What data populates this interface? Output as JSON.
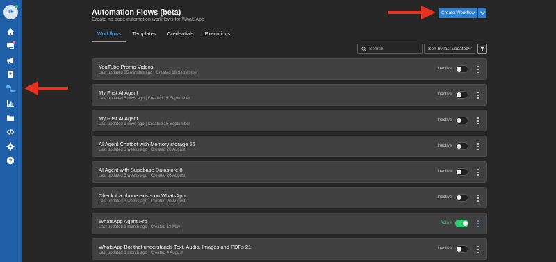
{
  "sidebar": {
    "avatar_initials": "TE",
    "items": [
      {
        "icon": "home-icon"
      },
      {
        "icon": "chat-icon"
      },
      {
        "icon": "megaphone-icon"
      },
      {
        "icon": "contacts-icon"
      },
      {
        "icon": "flows-icon",
        "active": true
      },
      {
        "icon": "analytics-icon"
      },
      {
        "icon": "folder-icon"
      },
      {
        "icon": "code-icon"
      },
      {
        "icon": "gear-icon"
      },
      {
        "icon": "help-icon"
      }
    ]
  },
  "header": {
    "title": "Automation Flows (beta)",
    "subtitle": "Create no-code automation workflows for WhatsApp",
    "create_button_label": "Create Workflow"
  },
  "tabs": [
    {
      "label": "Workflows",
      "active": true
    },
    {
      "label": "Templates"
    },
    {
      "label": "Credentials"
    },
    {
      "label": "Executions"
    }
  ],
  "toolbar": {
    "search_placeholder": "Search",
    "sort_label": "Sort by last updated"
  },
  "flows": [
    {
      "name": "YouTube Promo Videos",
      "meta": "Last updated 35 minutes ago | Created 19 September",
      "status": "Inactive",
      "active": false
    },
    {
      "name": "My First AI Agent",
      "meta": "Last updated 3 days ago | Created 15 September",
      "status": "Inactive",
      "active": false
    },
    {
      "name": "My First AI Agent",
      "meta": "Last updated 3 days ago | Created 15 September",
      "status": "Inactive",
      "active": false
    },
    {
      "name": "AI Agent Chatbot with Memory storage 56",
      "meta": "Last updated 3 weeks ago | Created 26 August",
      "status": "Inactive",
      "active": false
    },
    {
      "name": "AI Agent with Supabase Datastore 8",
      "meta": "Last updated 3 weeks ago | Created 26 August",
      "status": "Inactive",
      "active": false
    },
    {
      "name": "Check if a phone exists on WhatsApp",
      "meta": "Last updated 3 weeks ago | Created 20 August",
      "status": "Inactive",
      "active": false
    },
    {
      "name": "WhatsApp Agent Pro",
      "meta": "Last updated 1 month ago | Created 13 May",
      "status": "Active",
      "active": true
    },
    {
      "name": "WhatsApp Bot that understands Text, Audio, Images and PDFs 21",
      "meta": "Last updated 1 month ago | Created 4 August",
      "status": "Inactive",
      "active": false
    }
  ],
  "colors": {
    "sidebar": "#1e5fa8",
    "accent": "#2e7fd0",
    "active_green": "#2ecc71",
    "annotation_arrow": "#e8321f"
  }
}
